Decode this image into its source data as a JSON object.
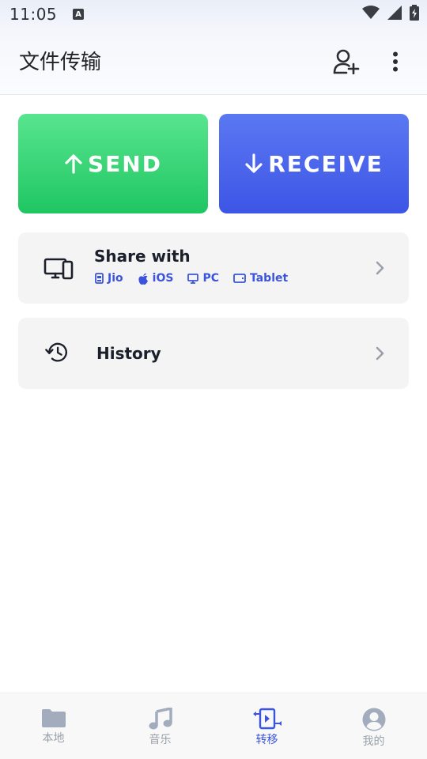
{
  "status": {
    "time": "11:05",
    "notif_letter": "A"
  },
  "app_bar": {
    "title": "文件传输"
  },
  "actions": {
    "send_label": "SEND",
    "receive_label": "RECEIVE"
  },
  "share": {
    "title": "Share with",
    "targets": [
      {
        "label": "Jio",
        "icon": "phone-icon"
      },
      {
        "label": "iOS",
        "icon": "apple-icon"
      },
      {
        "label": "PC",
        "icon": "monitor-icon"
      },
      {
        "label": "Tablet",
        "icon": "tablet-icon"
      }
    ]
  },
  "history": {
    "title": "History"
  },
  "bottom_nav": {
    "items": [
      {
        "label": "本地",
        "icon": "folder-icon"
      },
      {
        "label": "音乐",
        "icon": "music-icon"
      },
      {
        "label": "转移",
        "icon": "transfer-icon",
        "active": true
      },
      {
        "label": "我的",
        "icon": "profile-icon"
      }
    ]
  },
  "colors": {
    "accent": "#3b54d9",
    "send": "#22c866",
    "receive": "#4660ea",
    "inactive": "#9aa0aa"
  }
}
